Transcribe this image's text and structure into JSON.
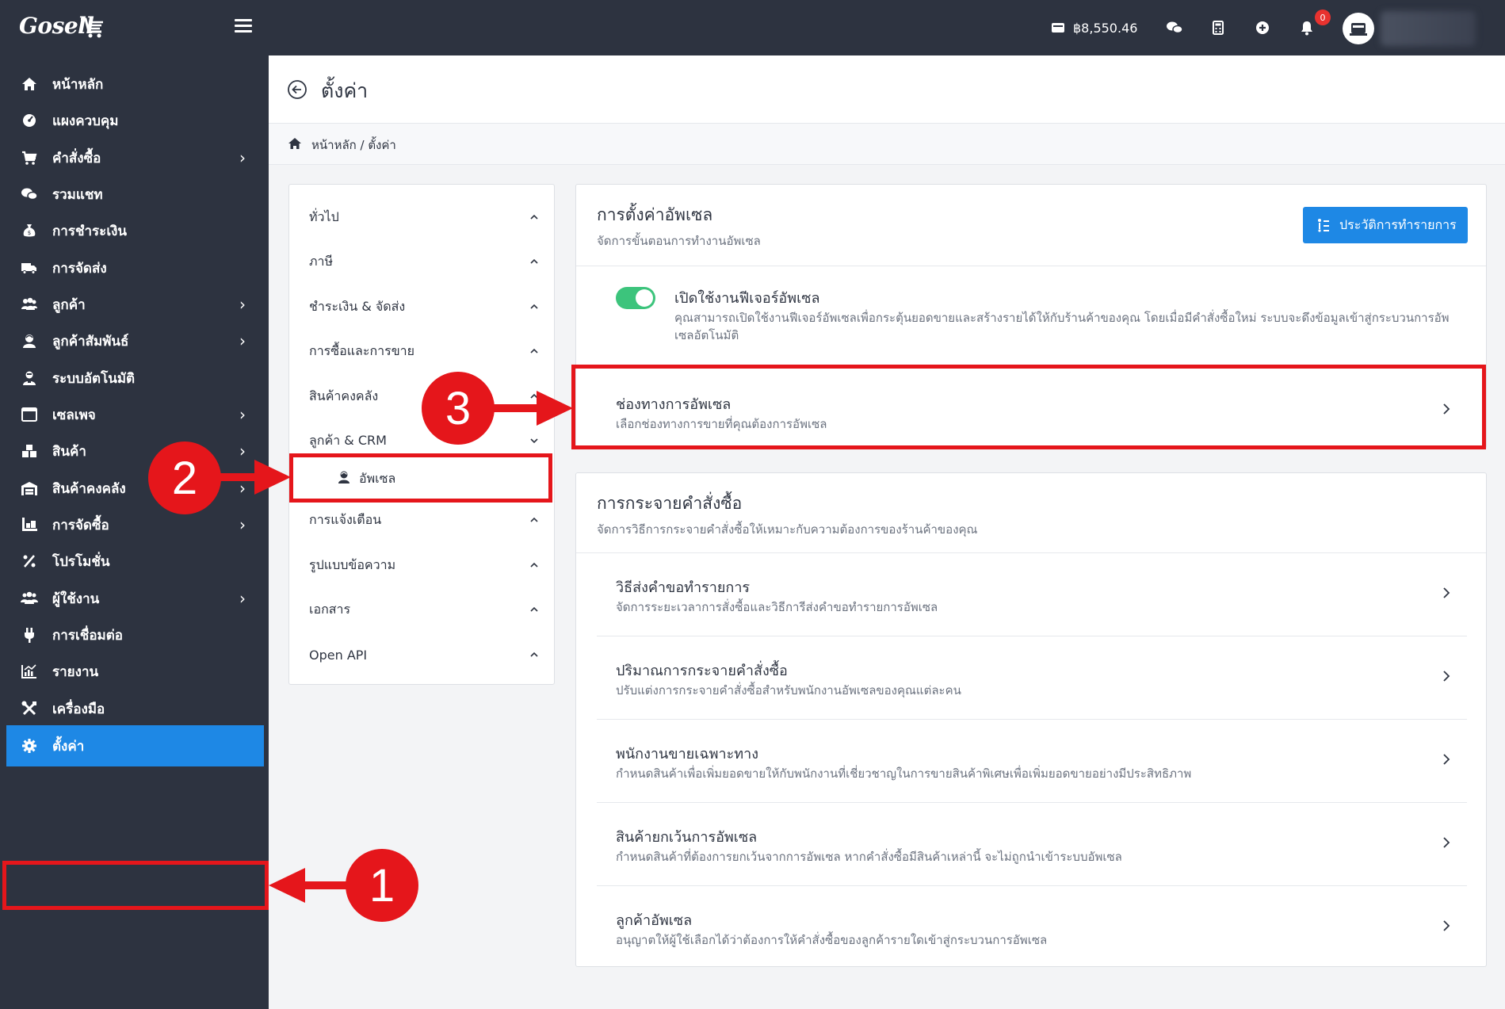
{
  "app": {
    "logo_text": "Gosell"
  },
  "topbar": {
    "balance": "฿8,550.46",
    "notification_count": "0",
    "icons": [
      "wallet-icon",
      "chat-icon",
      "calculator-icon",
      "plus-circle-icon",
      "bell-icon"
    ]
  },
  "sidebar": {
    "items": [
      {
        "label": "หน้าหลัก",
        "icon": "home-icon",
        "has_children": false
      },
      {
        "label": "แผงควบคุม",
        "icon": "dashboard-icon",
        "has_children": false
      },
      {
        "label": "คำสั่งซื้อ",
        "icon": "cart-icon",
        "has_children": true
      },
      {
        "label": "รวมแชท",
        "icon": "chat-icon",
        "has_children": false
      },
      {
        "label": "การชำระเงิน",
        "icon": "money-bag-icon",
        "has_children": false
      },
      {
        "label": "การจัดส่ง",
        "icon": "truck-icon",
        "has_children": false
      },
      {
        "label": "ลูกค้า",
        "icon": "users-icon",
        "has_children": true
      },
      {
        "label": "ลูกค้าสัมพันธ์",
        "icon": "customer-relations-icon",
        "has_children": true
      },
      {
        "label": "ระบบอัตโนมัติ",
        "icon": "robot-icon",
        "has_children": false
      },
      {
        "label": "เซลเพจ",
        "icon": "browser-window-icon",
        "has_children": true
      },
      {
        "label": "สินค้า",
        "icon": "boxes-icon",
        "has_children": true
      },
      {
        "label": "สินค้าคงคลัง",
        "icon": "warehouse-icon",
        "has_children": true
      },
      {
        "label": "การจัดซื้อ",
        "icon": "pallet-icon",
        "has_children": true
      },
      {
        "label": "โปรโมชั่น",
        "icon": "percent-icon",
        "has_children": false
      },
      {
        "label": "ผู้ใช้งาน",
        "icon": "user-group-icon",
        "has_children": true
      },
      {
        "label": "การเชื่อมต่อ",
        "icon": "plug-icon",
        "has_children": false
      },
      {
        "label": "รายงาน",
        "icon": "chart-icon",
        "has_children": false
      },
      {
        "label": "เครื่องมือ",
        "icon": "tools-icon",
        "has_children": false
      },
      {
        "label": "ตั้งค่า",
        "icon": "gear-icon",
        "has_children": false,
        "active": true
      }
    ]
  },
  "header": {
    "title": "ตั้งค่า"
  },
  "breadcrumb": {
    "text": "หน้าหลัก / ตั้งค่า"
  },
  "settings_menu": {
    "items": [
      {
        "label": "ทั่วไป",
        "expanded": false
      },
      {
        "label": "ภาษี",
        "expanded": false
      },
      {
        "label": "ชำระเงิน & จัดส่ง",
        "expanded": false
      },
      {
        "label": "การซื้อและการขาย",
        "expanded": false
      },
      {
        "label": "สินค้าคงคลัง",
        "expanded": false
      },
      {
        "label": "ลูกค้า & CRM",
        "expanded": true
      },
      {
        "label": "การแจ้งเตือน",
        "expanded": false
      },
      {
        "label": "รูปแบบข้อความ",
        "expanded": false
      },
      {
        "label": "เอกสาร",
        "expanded": false
      },
      {
        "label": "Open API",
        "expanded": false
      }
    ],
    "sub_item": {
      "label": "อัพเซล"
    }
  },
  "upsell_settings": {
    "title": "การตั้งค่าอัพเซล",
    "subtitle": "จัดการขั้นตอนการทำงานอัพเซล",
    "history_button": "ประวัติการทำรายการ",
    "toggle": {
      "title": "เปิดใช้งานฟีเจอร์อัพเซล",
      "description": "คุณสามารถเปิดใช้งานฟีเจอร์อัพเซลเพื่อกระตุ้นยอดขายและสร้างรายได้ให้กับร้านค้าของคุณ โดยเมื่อมีคำสั่งซื้อใหม่ ระบบจะดึงข้อมูลเข้าสู่กระบวนการอัพเซลอัตโนมัติ",
      "enabled": true
    },
    "channel": {
      "title": "ช่องทางการอัพเซล",
      "subtitle": "เลือกช่องทางการขายที่คุณต้องการอัพเซล"
    }
  },
  "order_distribution": {
    "title": "การกระจายคำสั่งซื้อ",
    "subtitle": "จัดการวิธีการกระจายคำสั่งซื้อให้เหมาะกับความต้องการของร้านค้าของคุณ",
    "rows": [
      {
        "title": "วิธีส่งคำขอทำรายการ",
        "subtitle": "จัดการระยะเวลาการสั่งซื้อและวิธีการีส่งคำขอทำรายการอัพเซล"
      },
      {
        "title": "ปริมาณการกระจายคำสั่งซื้อ",
        "subtitle": "ปรับแต่งการกระจายคำสั่งซื้อสำหรับพนักงานอัพเซลของคุณแต่ละคน"
      },
      {
        "title": "พนักงานขายเฉพาะทาง",
        "subtitle": "กำหนดสินค้าเพื่อเพิ่มยอดขายให้กับพนักงานที่เชี่ยวชาญในการขายสินค้าพิเศษเพื่อเพิ่มยอดขายอย่างมีประสิทธิภาพ"
      },
      {
        "title": "สินค้ายกเว้นการอัพเซล",
        "subtitle": "กำหนดสินค้าที่ต้องการยกเว้นจากการอัพเซล หากคำสั่งซื้อมีสินค้าเหล่านี้ จะไม่ถูกนำเข้าระบบอัพเซล"
      },
      {
        "title": "ลูกค้าอัพเซล",
        "subtitle": "อนุญาตให้ผู้ใช้เลือกได้ว่าต้องการให้คำสั่งซื้อของลูกค้ารายใดเข้าสู่กระบวนการอัพเซล"
      }
    ]
  },
  "annotations": {
    "step1": "1",
    "step2": "2",
    "step3": "3",
    "color": "#e5161b"
  },
  "colors": {
    "sidebar_bg": "#2d3340",
    "accent": "#1e88e5",
    "toggle_on": "#3cc47c"
  }
}
